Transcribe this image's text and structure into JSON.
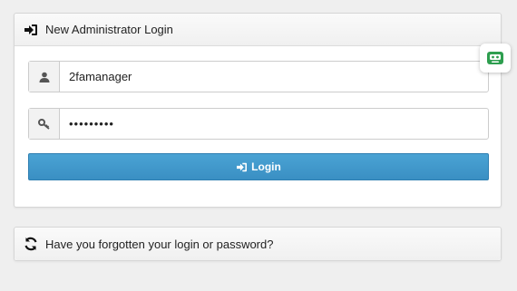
{
  "login_panel": {
    "title": "New Administrator Login",
    "title_icon": "sign-in-icon"
  },
  "form": {
    "username": {
      "icon": "user-icon",
      "value": "2famanager"
    },
    "password": {
      "icon": "key-icon",
      "value": "•••••••••"
    },
    "login_button": {
      "icon": "sign-in-icon",
      "label": "Login"
    }
  },
  "forgot_panel": {
    "title": "Have you forgotten your login or password?",
    "title_icon": "refresh-icon"
  },
  "extension_badge": {
    "icon": "password-manager-icon",
    "color": "#2e9e4f"
  },
  "colors": {
    "primary_button": "#3a8fc3",
    "background": "#efefef"
  }
}
